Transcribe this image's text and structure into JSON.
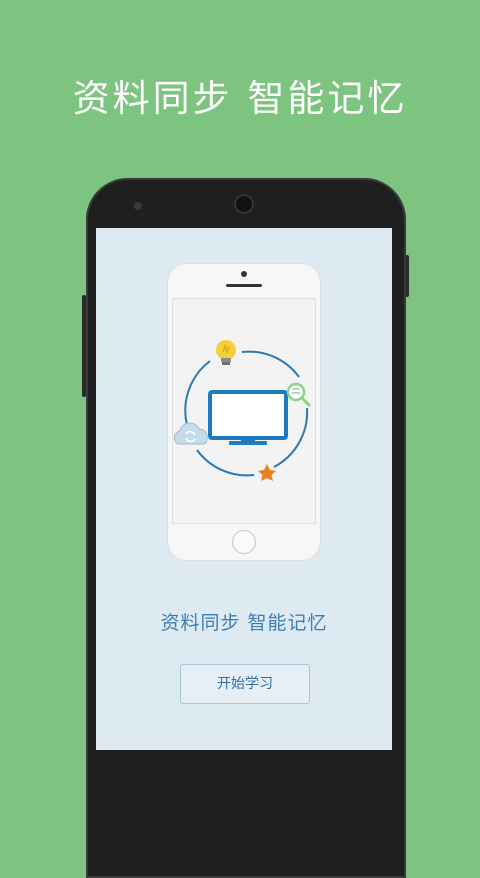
{
  "headline": "资料同步 智能记忆",
  "tagline": "资料同步 智能记忆",
  "start_button": "开始学习",
  "colors": {
    "background": "#7cc47f",
    "screen": "#deeaf2",
    "accent": "#3d7fb5",
    "monitor": "#1e7bbf",
    "star": "#e8821e",
    "bulb": "#f5cf3a",
    "magnifier": "#8fd08a"
  },
  "icons": [
    "lightbulb-icon",
    "monitor-icon",
    "cloud-sync-icon",
    "magnifier-icon",
    "star-icon"
  ]
}
